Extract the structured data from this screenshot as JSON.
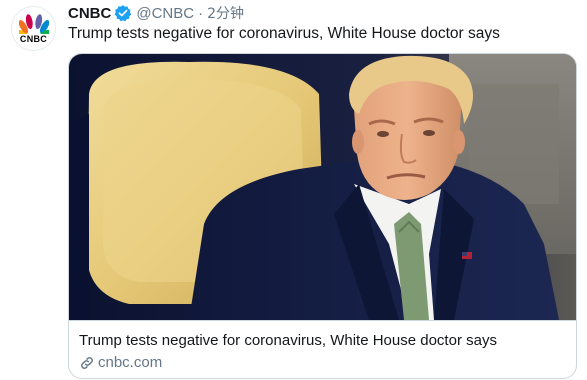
{
  "author": {
    "name": "CNBC",
    "handle": "@CNBC",
    "separator": "·",
    "timestamp": "2分钟",
    "verified": true,
    "avatar_wordmark": "CNBC",
    "avatar_icon": "peacock-logo"
  },
  "tweet": {
    "text": "Trump tests negative for coronavirus, White House doctor says"
  },
  "card": {
    "image_icon": "article-photo",
    "title": "Trump tests negative for coronavirus, White House doctor says",
    "domain": "cnbc.com",
    "domain_icon": "link-icon"
  },
  "colors": {
    "text_primary": "#14171a",
    "text_secondary": "#657786",
    "verified_blue": "#1da1f2",
    "card_border": "#ccd6dd",
    "peacock": [
      "#f37021",
      "#fcb711",
      "#cc004c",
      "#6460aa",
      "#0089d0",
      "#0db14b"
    ]
  }
}
